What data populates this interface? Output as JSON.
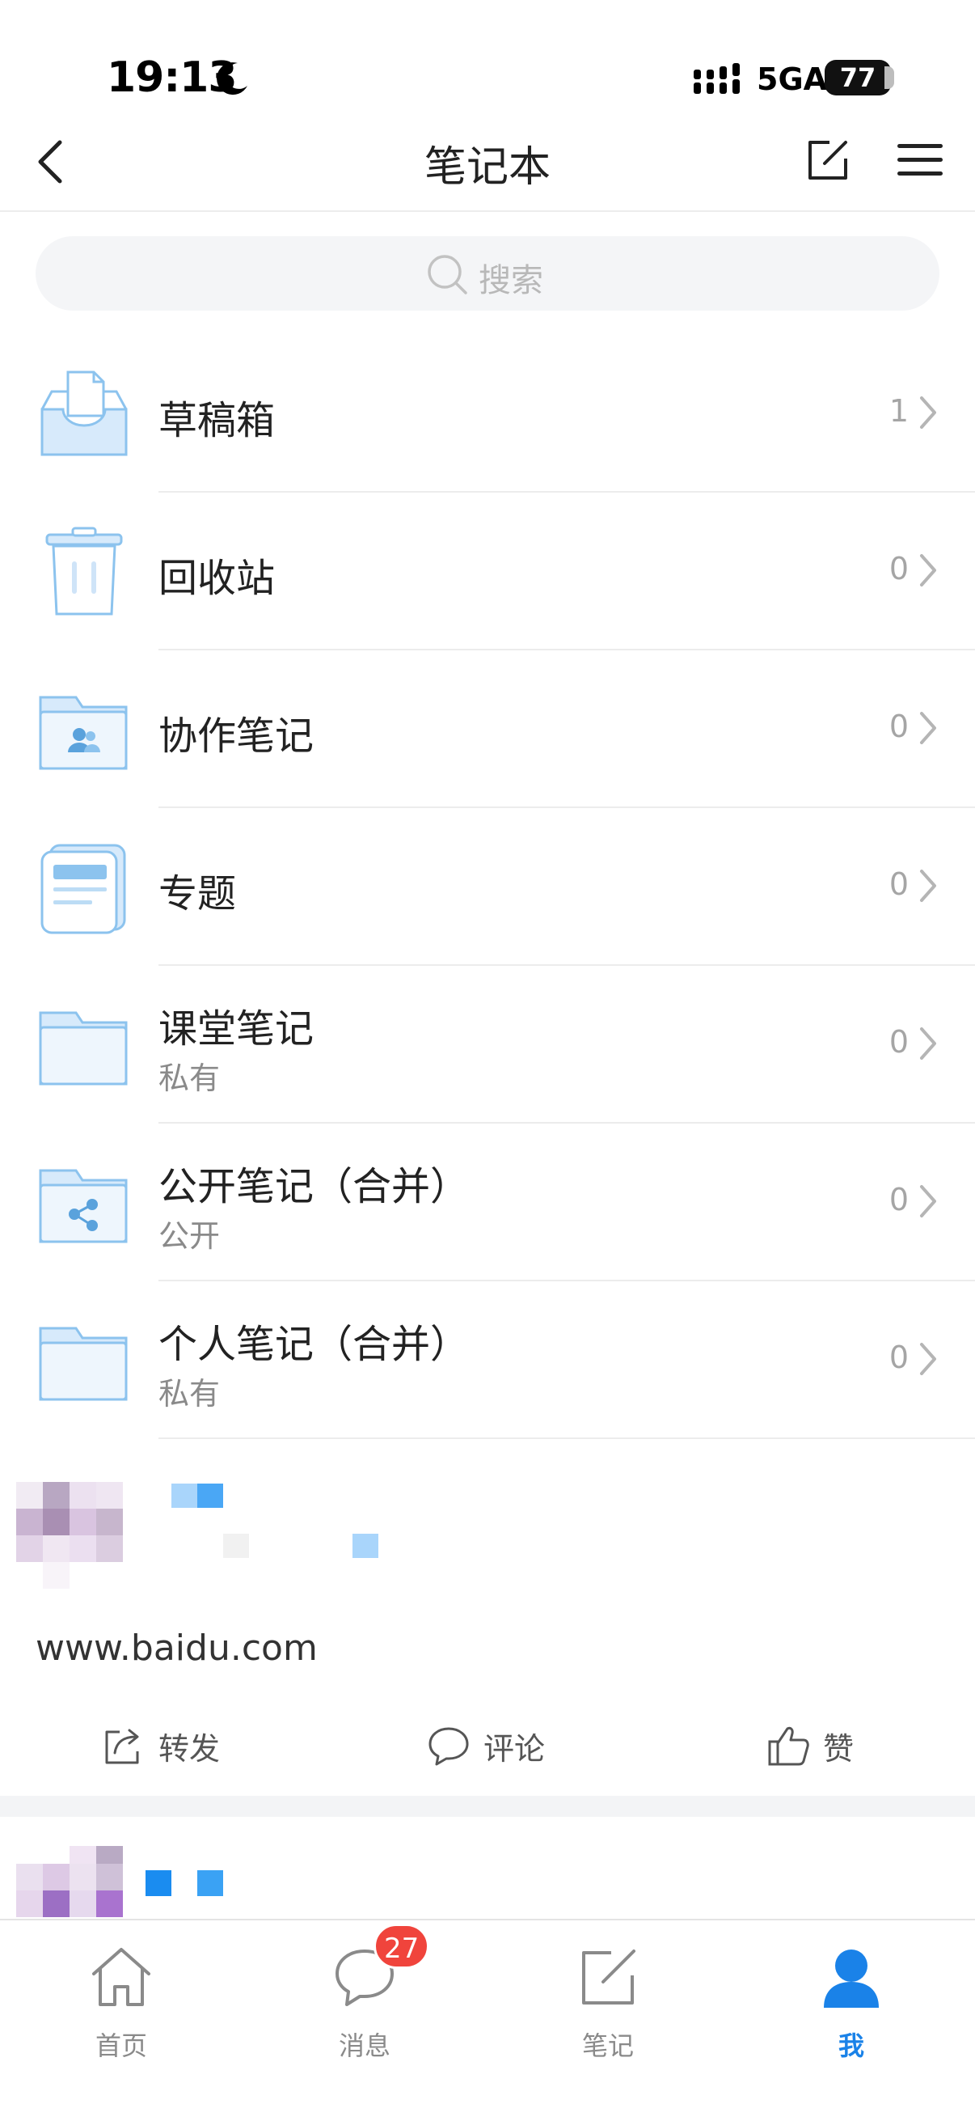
{
  "status_bar": {
    "time": "19:13",
    "network": "5GA",
    "battery": "77"
  },
  "nav": {
    "title": "笔记本"
  },
  "search": {
    "placeholder": "搜索"
  },
  "notebooks": [
    {
      "title": "草稿箱",
      "subtitle": "",
      "count": "1",
      "icon": "inbox-tray-icon"
    },
    {
      "title": "回收站",
      "subtitle": "",
      "count": "0",
      "icon": "trash-bin-icon"
    },
    {
      "title": "协作笔记",
      "subtitle": "",
      "count": "0",
      "icon": "shared-folder-icon"
    },
    {
      "title": "专题",
      "subtitle": "",
      "count": "0",
      "icon": "topic-stack-icon"
    },
    {
      "title": "课堂笔记",
      "subtitle": "私有",
      "count": "0",
      "icon": "folder-icon"
    },
    {
      "title": "公开笔记（合并）",
      "subtitle": "公开",
      "count": "0",
      "icon": "share-folder-icon"
    },
    {
      "title": "个人笔记（合并）",
      "subtitle": "私有",
      "count": "0",
      "icon": "folder-icon"
    }
  ],
  "feed": {
    "link": "www.baidu.com",
    "actions": {
      "forward": "转发",
      "comment": "评论",
      "like": "赞"
    }
  },
  "tabbar": {
    "tabs": [
      {
        "label": "首页",
        "icon": "home-icon"
      },
      {
        "label": "消息",
        "icon": "chat-bubble-icon"
      },
      {
        "label": "笔记",
        "icon": "note-edit-icon"
      },
      {
        "label": "我",
        "icon": "person-icon"
      }
    ],
    "message_badge": "27",
    "active_color": "#1a82e8"
  }
}
